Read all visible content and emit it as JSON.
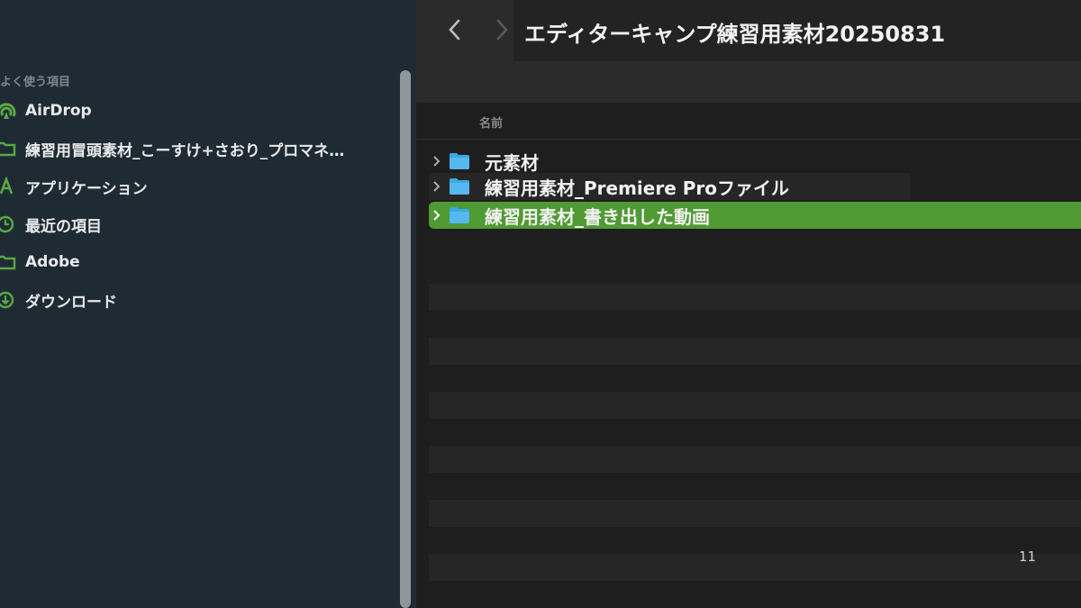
{
  "sidebar": {
    "section_title": "よく使う項目",
    "items": [
      {
        "label": "AirDrop",
        "icon": "airdrop-icon"
      },
      {
        "label": "練習用冒頭素材_こーすけ+さおり_プロマネ…",
        "icon": "folder-icon"
      },
      {
        "label": "アプリケーション",
        "icon": "applications-icon"
      },
      {
        "label": "最近の項目",
        "icon": "clock-icon"
      },
      {
        "label": "Adobe",
        "icon": "folder-icon"
      },
      {
        "label": "ダウンロード",
        "icon": "download-icon"
      }
    ]
  },
  "toolbar": {
    "title": "エディターキャンプ練習用素材20250831"
  },
  "list": {
    "column_name": "名前",
    "rows": [
      {
        "name": "元素材",
        "selected": false
      },
      {
        "name": "練習用素材_Premiere Proファイル",
        "selected": false
      },
      {
        "name": "練習用素材_書き出した動画",
        "selected": true
      }
    ]
  },
  "page_number": "11",
  "colors": {
    "sidebar_bg": "#1f2b33",
    "accent_green": "#4f9a33",
    "icon_green": "#5aa845",
    "folder_blue": "#3aa8e6"
  }
}
